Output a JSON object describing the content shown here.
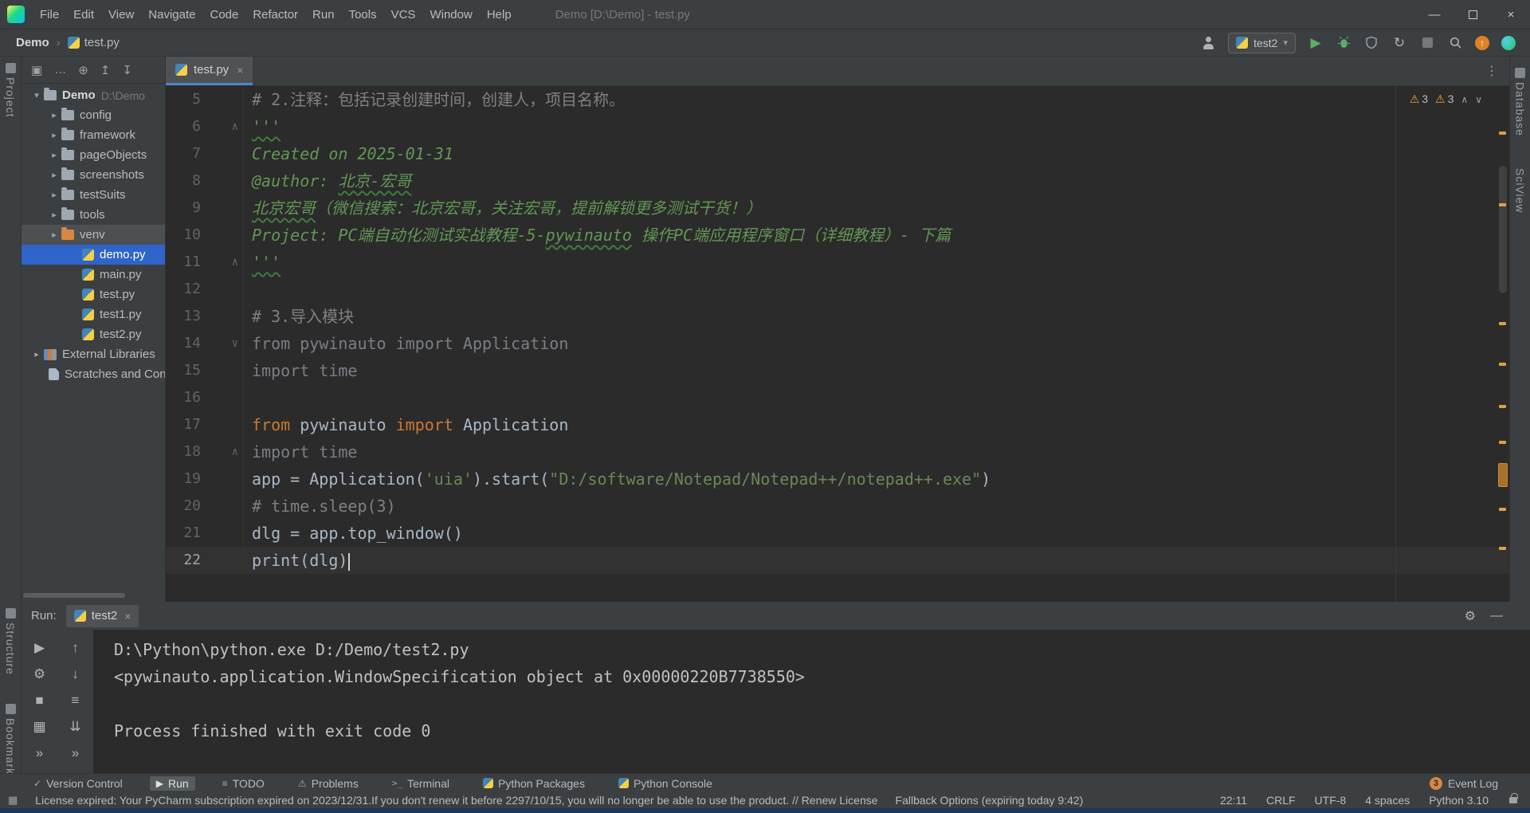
{
  "colors": {
    "selection_blue": "#2f65ca",
    "editor_bg": "#2b2b2b",
    "panel_bg": "#3c3f41",
    "keyword": "#cc7832",
    "string": "#6a8759",
    "comment": "#808080",
    "docstring": "#629755",
    "default_text": "#a9b7c6",
    "warning_yellow": "#f0a732",
    "run_green": "#5fad65",
    "excluded_orange": "#d98641",
    "tab_underline": "#4a88c7"
  },
  "icons": {
    "close": "×",
    "kebab": "⋮",
    "gear": "⚙",
    "minimize": "—",
    "chevron_down": "▾",
    "chevron_right": "▸",
    "fold_up": "∧",
    "fold_down": "∨",
    "warning": "⚠",
    "play": "▶",
    "refresh": "↻",
    "up_arrow": "↑"
  },
  "title_bar": {
    "menus": [
      "File",
      "Edit",
      "View",
      "Navigate",
      "Code",
      "Refactor",
      "Run",
      "Tools",
      "VCS",
      "Window",
      "Help"
    ],
    "title": "Demo [D:\\Demo] - test.py"
  },
  "nav": {
    "breadcrumb_project": "Demo",
    "breadcrumb_separator": "›",
    "breadcrumb_file": "test.py",
    "run_config": "test2"
  },
  "project_panel": {
    "header_icons": [
      {
        "name": "view-options-icon",
        "glyph": "▣"
      },
      {
        "name": "more-options-icon",
        "glyph": "…"
      },
      {
        "name": "locate-file-icon",
        "glyph": "⊕"
      },
      {
        "name": "expand-all-icon",
        "glyph": "↥"
      },
      {
        "name": "collapse-all-icon",
        "glyph": "↧"
      }
    ],
    "tree": [
      {
        "label": "Demo",
        "sub": "D:\\Demo",
        "icon": "folder",
        "chev": "down",
        "indent": 10,
        "bold": true
      },
      {
        "label": "config",
        "icon": "folder",
        "chev": "right",
        "indent": 32
      },
      {
        "label": "framework",
        "icon": "folder",
        "chev": "right",
        "indent": 32
      },
      {
        "label": "pageObjects",
        "icon": "folder",
        "chev": "right",
        "indent": 32
      },
      {
        "label": "screenshots",
        "icon": "folder",
        "chev": "right",
        "indent": 32
      },
      {
        "label": "testSuits",
        "icon": "folder",
        "chev": "right",
        "indent": 32
      },
      {
        "label": "tools",
        "icon": "folder",
        "chev": "right",
        "indent": 32
      },
      {
        "label": "venv",
        "icon": "folder-excluded",
        "chev": "right",
        "indent": 32,
        "excluded": true
      },
      {
        "label": "demo.py",
        "icon": "python",
        "chev": "none",
        "indent": 76,
        "selected": true
      },
      {
        "label": "main.py",
        "icon": "python",
        "chev": "none",
        "indent": 76
      },
      {
        "label": "test.py",
        "icon": "python",
        "chev": "none",
        "indent": 76
      },
      {
        "label": "test1.py",
        "icon": "python",
        "chev": "none",
        "indent": 76
      },
      {
        "label": "test2.py",
        "icon": "python",
        "chev": "none",
        "indent": 76
      },
      {
        "label": "External Libraries",
        "icon": "libraries",
        "chev": "right",
        "indent": 10
      },
      {
        "label": "Scratches and Con",
        "icon": "scratches",
        "chev": "none",
        "indent": 34
      }
    ]
  },
  "editor": {
    "tab": "test.py",
    "inspections": {
      "warnings": "3",
      "weak_warnings": "3"
    },
    "stripe_marks": [
      57,
      147,
      296,
      347,
      400,
      445,
      529,
      578
    ],
    "lines": [
      {
        "n": "5",
        "seg": [
          {
            "t": "# 2.注释：包括记录创建时间，创建人，项目名称。",
            "c": "com"
          }
        ]
      },
      {
        "n": "6",
        "fold": "up",
        "seg": [
          {
            "t": "'''",
            "c": "doc",
            "w": true
          }
        ]
      },
      {
        "n": "7",
        "seg": [
          {
            "t": "Created on 2025-01-31",
            "c": "doc"
          }
        ]
      },
      {
        "n": "8",
        "seg": [
          {
            "t": "@author: ",
            "c": "doc"
          },
          {
            "t": "北京-宏哥",
            "c": "doc",
            "w": true
          }
        ]
      },
      {
        "n": "9",
        "seg": [
          {
            "t": "北京宏哥",
            "c": "doc",
            "w": true
          },
          {
            "t": "（微信搜索：北京宏哥，关注宏哥，提前解锁更多测试干货！）",
            "c": "doc"
          }
        ]
      },
      {
        "n": "10",
        "seg": [
          {
            "t": "Project: PC端自动化测试实战教程-5-",
            "c": "doc"
          },
          {
            "t": "pywinauto",
            "c": "doc",
            "w": true
          },
          {
            "t": " 操作PC端应用程序窗口（详细教程）- 下篇",
            "c": "doc"
          }
        ]
      },
      {
        "n": "11",
        "fold": "up",
        "seg": [
          {
            "t": "'''",
            "c": "doc",
            "w": true
          }
        ]
      },
      {
        "n": "12",
        "seg": []
      },
      {
        "n": "13",
        "seg": [
          {
            "t": "# 3.导入模块",
            "c": "com"
          }
        ]
      },
      {
        "n": "14",
        "fold": "down",
        "seg": [
          {
            "t": "from pywinauto import Application",
            "c": "gray"
          }
        ]
      },
      {
        "n": "15",
        "seg": [
          {
            "t": "import time",
            "c": "gray"
          }
        ]
      },
      {
        "n": "16",
        "seg": []
      },
      {
        "n": "17",
        "seg": [
          {
            "t": "from ",
            "c": "kw"
          },
          {
            "t": "pywinauto ",
            "c": "def"
          },
          {
            "t": "import ",
            "c": "kw"
          },
          {
            "t": "Application",
            "c": "def"
          }
        ]
      },
      {
        "n": "18",
        "fold": "up",
        "seg": [
          {
            "t": "import time",
            "c": "gray"
          }
        ]
      },
      {
        "n": "19",
        "seg": [
          {
            "t": "app = Application(",
            "c": "def"
          },
          {
            "t": "'uia'",
            "c": "str"
          },
          {
            "t": ").start(",
            "c": "def"
          },
          {
            "t": "\"D:/software/Notepad/Notepad++/notepad++.exe\"",
            "c": "str"
          },
          {
            "t": ")",
            "c": "def"
          }
        ]
      },
      {
        "n": "20",
        "seg": [
          {
            "t": "# time.sleep(3)",
            "c": "com"
          }
        ]
      },
      {
        "n": "21",
        "seg": [
          {
            "t": "dlg = app.top_window()",
            "c": "def"
          }
        ]
      },
      {
        "n": "22",
        "current": true,
        "cursor": true,
        "seg": [
          {
            "t": "print(dlg)",
            "c": "def"
          }
        ]
      }
    ]
  },
  "run_panel": {
    "label": "Run:",
    "tab": "test2",
    "toolbar": {
      "col1": [
        {
          "name": "rerun-icon",
          "glyph": "▶",
          "cls": "green"
        },
        {
          "name": "wrench-icon",
          "glyph": "⚙"
        },
        {
          "name": "stop-icon",
          "glyph": "■"
        },
        {
          "name": "restore-layout-icon",
          "glyph": "▦"
        },
        {
          "name": "more-icon",
          "glyph": "»"
        }
      ],
      "col2": [
        {
          "name": "up-stack-icon",
          "glyph": "↑"
        },
        {
          "name": "down-stack-icon",
          "glyph": "↓"
        },
        {
          "name": "soft-wrap-icon",
          "glyph": "≡"
        },
        {
          "name": "scroll-to-end-icon",
          "glyph": "⇊"
        },
        {
          "name": "more-icon",
          "glyph": "»"
        }
      ]
    },
    "console": [
      "D:\\Python\\python.exe D:/Demo/test2.py",
      "<pywinauto.application.WindowSpecification object at 0x00000220B7738550>",
      "",
      "Process finished with exit code 0"
    ]
  },
  "tool_windows": {
    "items": [
      {
        "label": "Version Control",
        "icon": "version-control",
        "glyph": "✓"
      },
      {
        "label": "Run",
        "icon": "run",
        "glyph": "▶",
        "selected": true
      },
      {
        "label": "TODO",
        "icon": "todo",
        "glyph": "≡"
      },
      {
        "label": "Problems",
        "icon": "problems",
        "glyph": "⚠"
      },
      {
        "label": "Terminal",
        "icon": "terminal",
        "glyph": ">_"
      },
      {
        "label": "Python Packages",
        "icon": "python",
        "glyph": ""
      },
      {
        "label": "Python Console",
        "icon": "python",
        "glyph": ""
      }
    ],
    "event_log": {
      "badge": "3",
      "label": "Event Log"
    }
  },
  "status_bar": {
    "message": "License expired: Your PyCharm subscription expired on 2023/12/31.If you don't renew it before 2297/10/15, you will no longer be able to use the product. // Renew License",
    "fallback": "Fallback Options (expiring today 9:42)",
    "right": [
      {
        "name": "cursor-position",
        "label": "22:11"
      },
      {
        "name": "line-separator",
        "label": "CRLF"
      },
      {
        "name": "encoding",
        "label": "UTF-8"
      },
      {
        "name": "indent",
        "label": "4 spaces"
      },
      {
        "name": "interpreter",
        "label": "Python 3.10"
      }
    ]
  },
  "stripes": {
    "project": "Project",
    "structure": "Structure",
    "bookmarks": "Bookmarks",
    "database": "Database",
    "sciview": "SciView"
  }
}
